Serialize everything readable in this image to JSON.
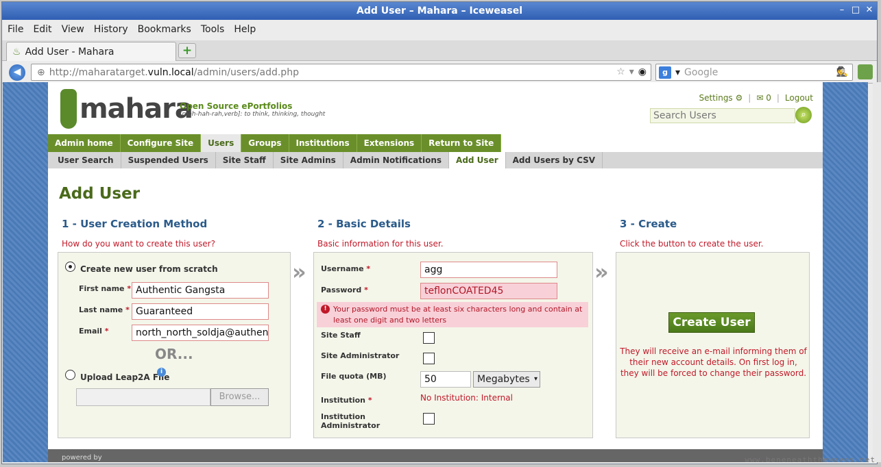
{
  "window": {
    "title": "Add User – Mahara – Iceweasel"
  },
  "menu": [
    "File",
    "Edit",
    "View",
    "History",
    "Bookmarks",
    "Tools",
    "Help"
  ],
  "tab": {
    "label": "Add User - Mahara",
    "newtab": "+"
  },
  "url": {
    "prefix": "http://maharatarget.",
    "domain": "vuln.local",
    "path": "/admin/users/add.php"
  },
  "websearch": {
    "engine": "g",
    "placeholder": "Google"
  },
  "header": {
    "logo": "mahara",
    "tagline": "Open Source ePortfolios",
    "subtagline": "[mah-hah-rah,verb]: to think, thinking, thought",
    "settings": "Settings",
    "messages": "0",
    "logout": "Logout",
    "search_placeholder": "Search Users",
    "sep": "|"
  },
  "mainnav": [
    "Admin home",
    "Configure Site",
    "Users",
    "Groups",
    "Institutions",
    "Extensions",
    "Return to Site"
  ],
  "subnav": [
    "User Search",
    "Suspended Users",
    "Site Staff",
    "Site Admins",
    "Admin Notifications",
    "Add User",
    "Add Users by CSV"
  ],
  "page": {
    "title": "Add User"
  },
  "col1": {
    "heading": "1 - User Creation Method",
    "desc": "How do you want to create this user?",
    "option_scratch": "Create new user from scratch",
    "firstname_label": "First name",
    "firstname": "Authentic Gangsta",
    "lastname_label": "Last name",
    "lastname": "Guaranteed",
    "email_label": "Email",
    "email": "north_north_soldja@authentic",
    "or": "OR...",
    "option_leap": "Upload Leap2A File",
    "browse": "Browse...",
    "req": "*"
  },
  "col2": {
    "heading": "2 - Basic Details",
    "desc": "Basic information for this user.",
    "username_label": "Username",
    "username": "agg",
    "password_label": "Password",
    "password": "teflonCOATED45",
    "password_error": "Your password must be at least six characters long and contain at least one digit and two letters",
    "sitestaff_label": "Site Staff",
    "siteadmin_label": "Site Administrator",
    "quota_label": "File quota (MB)",
    "quota": "50",
    "quota_unit": "Megabytes",
    "institution_label": "Institution",
    "institution": "No Institution: Internal",
    "instadmin_label": "Institution Administrator",
    "req": "*"
  },
  "col3": {
    "heading": "3 - Create",
    "desc": "Click the button to create the user.",
    "button": "Create User",
    "note": "They will receive an e-mail informing them of their new account details. On first log in, they will be forced to change their password."
  },
  "arrows": "»",
  "footer": "powered by",
  "watermark": "www.beneneaththewaves.net"
}
